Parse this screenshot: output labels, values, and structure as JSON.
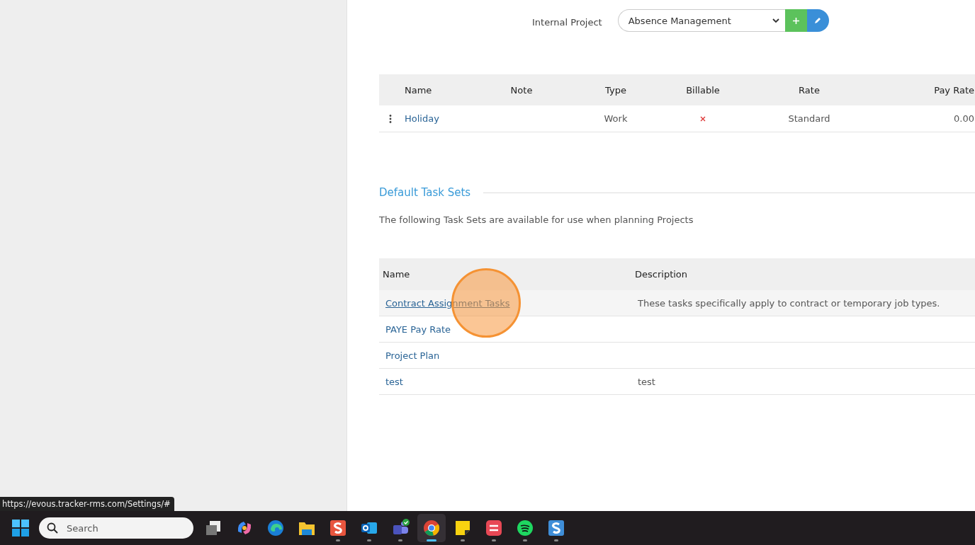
{
  "internal_project": {
    "label": "Internal Project",
    "value": "Absence Management"
  },
  "tasks_table": {
    "columns": [
      "Name",
      "Note",
      "Type",
      "Billable",
      "Rate",
      "Pay Rate"
    ],
    "rows": [
      {
        "name": "Holiday",
        "note": "",
        "type": "Work",
        "billable": false,
        "rate": "Standard",
        "pay_rate": "0.00"
      }
    ]
  },
  "task_sets": {
    "title": "Default Task Sets",
    "description": "The following Task Sets are available for use when planning Projects",
    "columns": [
      "Name",
      "Description"
    ],
    "rows": [
      {
        "name": "Contract Assignment Tasks",
        "description": "These tasks specifically apply to contract or temporary job types.",
        "hovered": true
      },
      {
        "name": "PAYE Pay Rate",
        "description": "",
        "hovered": false
      },
      {
        "name": "Project Plan",
        "description": "",
        "hovered": false
      },
      {
        "name": "test",
        "description": "test",
        "hovered": false
      }
    ]
  },
  "status_url": "https://evous.tracker-rms.com/Settings/#",
  "taskbar": {
    "search_placeholder": "Search",
    "apps": [
      {
        "kind": "taskview",
        "selected": false,
        "running": false
      },
      {
        "kind": "copilot",
        "selected": false,
        "running": false
      },
      {
        "kind": "edge",
        "selected": false,
        "running": false
      },
      {
        "kind": "folder",
        "selected": false,
        "running": false
      },
      {
        "kind": "snag-red",
        "selected": false,
        "running": true
      },
      {
        "kind": "outlook",
        "selected": false,
        "running": true
      },
      {
        "kind": "teams",
        "selected": false,
        "running": true
      },
      {
        "kind": "chrome",
        "selected": true,
        "running": true
      },
      {
        "kind": "note",
        "selected": false,
        "running": true
      },
      {
        "kind": "stripes",
        "selected": false,
        "running": true
      },
      {
        "kind": "spotify",
        "selected": false,
        "running": true
      },
      {
        "kind": "snag-blue",
        "selected": false,
        "running": true
      }
    ]
  }
}
